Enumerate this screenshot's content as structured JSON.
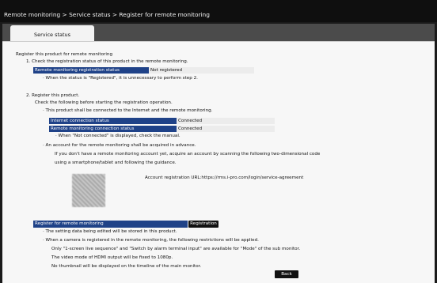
{
  "breadcrumb": "Remote monitoring > Service status > Register for remote monitoring",
  "tab": "Service status",
  "section_title": "Register this product for remote monitoring",
  "step1": {
    "heading": "1. Check the registration status of this product in the remote monitoring.",
    "label": "Remote monitoring registration status",
    "value": "Not registered",
    "note": "· When the status is \"Registered\", it is unnecessary to perform step 2."
  },
  "step2": {
    "heading": "2. Register this product.",
    "intro": "Check the following before starting the registration operation.",
    "bullet1": "· This product shall be connected to the Internet and the remote monitoring.",
    "internet_label": "Internet connection status",
    "internet_value": "Connected",
    "remote_label": "Remote monitoring connection status",
    "remote_value": "Connected",
    "note": "· When \"Not connected\" is displayed, check the manual.",
    "bullet2": "· An account for the remote monitoring shall be acquired in advance.",
    "account_line1": "If you don't have a remote monitoring account yet, acquire an account by scanning the following two-dimensional code",
    "account_line2": "using a smartphone/tablet and following the guidance.",
    "account_url": "Account registration URL:https://rms.i-pro.com/login/service-agreement"
  },
  "register": {
    "label": "Register for remote monitoring",
    "button": "Registration",
    "note1": "· The setting data being edited will be stored in this product.",
    "note2": "· When a camera is registered in the remote monitoring, the following restrictions will be applied.",
    "restrict1": "Only \"1-screen live sequence\" and \"Switch by alarm terminal input\" are available for \"Mode\" of the sub monitor.",
    "restrict2": "The video mode of HDMI output will be fixed to 1080p.",
    "restrict3": "No thumbnail will be displayed on the timeline of the main monitor."
  },
  "back_button": "Back"
}
